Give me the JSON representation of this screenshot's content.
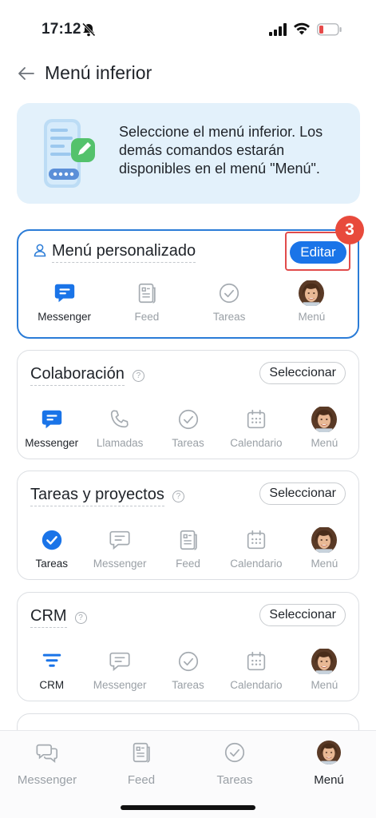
{
  "status_bar": {
    "time": "17:12"
  },
  "header": {
    "title": "Menú inferior"
  },
  "banner": {
    "text": "Seleccione el menú inferior. Los demás comandos estarán disponibles en el menú \"Menú\"."
  },
  "custom_menu": {
    "title": "Menú personalizado",
    "edit_label": "Editar",
    "step_number": "3",
    "items": [
      "Messenger",
      "Feed",
      "Tareas",
      "Menú"
    ]
  },
  "collaboration": {
    "title": "Colaboración",
    "select_label": "Seleccionar",
    "items": [
      "Messenger",
      "Llamadas",
      "Tareas",
      "Calendario",
      "Menú"
    ]
  },
  "tasks_projects": {
    "title": "Tareas y proyectos",
    "select_label": "Seleccionar",
    "items": [
      "Tareas",
      "Messenger",
      "Feed",
      "Calendario",
      "Menú"
    ]
  },
  "crm": {
    "title": "CRM",
    "select_label": "Seleccionar",
    "items": [
      "CRM",
      "Messenger",
      "Tareas",
      "Calendario",
      "Menú"
    ]
  },
  "bottom_nav": {
    "items": [
      "Messenger",
      "Feed",
      "Tareas",
      "Menú"
    ]
  },
  "colors": {
    "accent": "#1a74e8",
    "highlight": "#e14b4b",
    "banner_bg": "#e3f1fb"
  }
}
